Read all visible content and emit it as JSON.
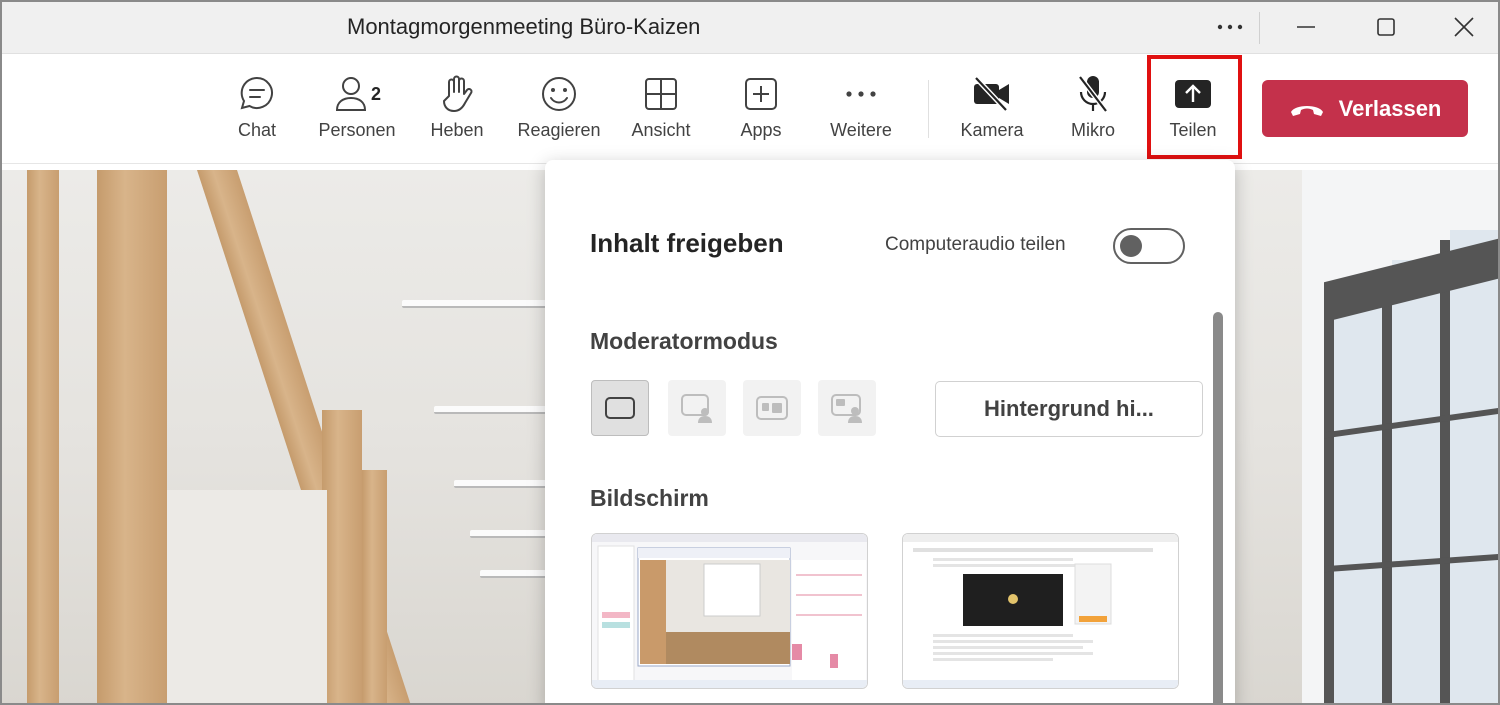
{
  "window": {
    "title": "Montagmorgenmeeting Büro-Kaizen",
    "controls": [
      "more-icon",
      "minimize-icon",
      "maximize-icon",
      "close-icon"
    ]
  },
  "toolbar": {
    "items": [
      {
        "label": "Chat",
        "icon": "chat-icon"
      },
      {
        "label": "Personen",
        "icon": "people-icon",
        "badge": "2"
      },
      {
        "label": "Heben",
        "icon": "hand-icon"
      },
      {
        "label": "Reagieren",
        "icon": "emoji-icon"
      },
      {
        "label": "Ansicht",
        "icon": "grid-icon"
      },
      {
        "label": "Apps",
        "icon": "apps-plus-icon"
      },
      {
        "label": "Weitere",
        "icon": "more-icon"
      },
      {
        "label": "Kamera",
        "icon": "camera-off-icon"
      },
      {
        "label": "Mikro",
        "icon": "mic-off-icon"
      },
      {
        "label": "Teilen",
        "icon": "share-icon"
      }
    ],
    "leave_label": "Verlassen",
    "leave_color": "#c4314b",
    "highlight_color": "#e01010"
  },
  "share_panel": {
    "title": "Inhalt freigeben",
    "audio_label": "Computeraudio teilen",
    "audio_toggle_on": false,
    "presenter_mode_label": "Moderatormodus",
    "presenter_modes": [
      {
        "icon": "content-only-icon",
        "selected": true
      },
      {
        "icon": "standout-icon",
        "selected": false
      },
      {
        "icon": "side-by-side-icon",
        "selected": false
      },
      {
        "icon": "reporter-icon",
        "selected": false
      }
    ],
    "background_button": "Hintergrund hi...",
    "screen_label": "Bildschirm"
  }
}
